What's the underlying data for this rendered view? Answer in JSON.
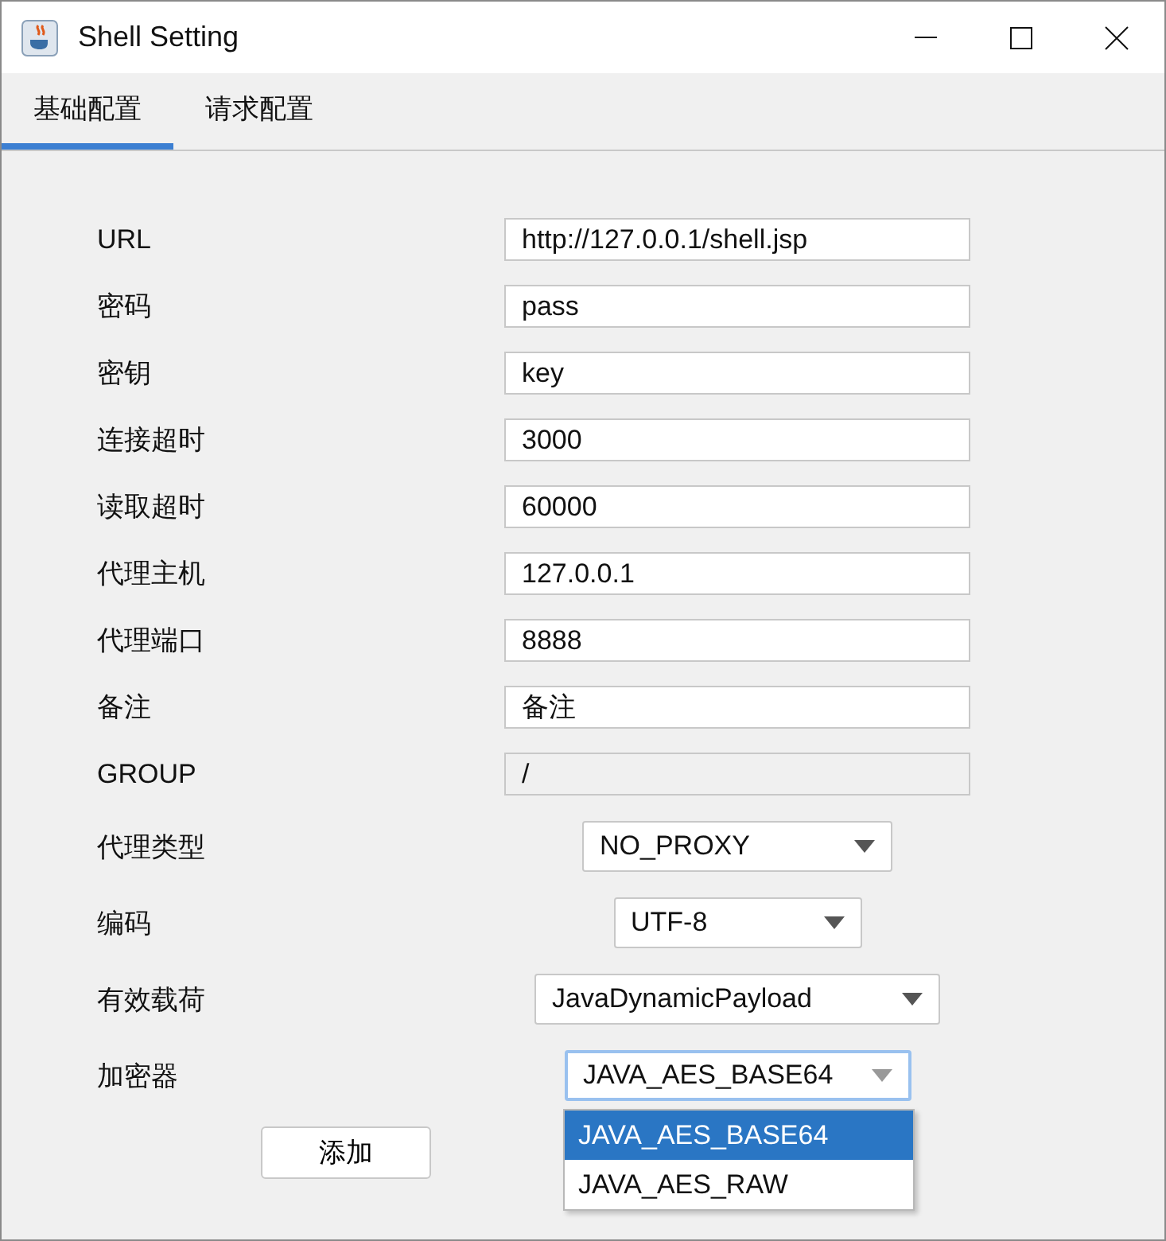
{
  "window": {
    "title": "Shell Setting"
  },
  "tabs": [
    {
      "label": "基础配置",
      "selected": true
    },
    {
      "label": "请求配置",
      "selected": false
    }
  ],
  "fields": [
    {
      "label": "URL",
      "value": "http://127.0.0.1/shell.jsp",
      "disabled": false
    },
    {
      "label": "密码",
      "value": "pass",
      "disabled": false
    },
    {
      "label": "密钥",
      "value": "key",
      "disabled": false
    },
    {
      "label": "连接超时",
      "value": "3000",
      "disabled": false
    },
    {
      "label": "读取超时",
      "value": "60000",
      "disabled": false
    },
    {
      "label": "代理主机",
      "value": "127.0.0.1",
      "disabled": false
    },
    {
      "label": "代理端口",
      "value": "8888",
      "disabled": false
    },
    {
      "label": "备注",
      "value": "备注",
      "disabled": false
    },
    {
      "label": "GROUP",
      "value": "/",
      "disabled": true
    }
  ],
  "combos": [
    {
      "label": "代理类型",
      "value": "NO_PROXY",
      "focused": false,
      "expanded": false
    },
    {
      "label": "编码",
      "value": "UTF-8",
      "focused": false,
      "expanded": false
    },
    {
      "label": "有效载荷",
      "value": "JavaDynamicPayload",
      "focused": false,
      "expanded": false
    },
    {
      "label": "加密器",
      "value": "JAVA_AES_BASE64",
      "focused": true,
      "expanded": true,
      "options": [
        {
          "label": "JAVA_AES_BASE64",
          "selected": true
        },
        {
          "label": "JAVA_AES_RAW",
          "selected": false
        }
      ]
    }
  ],
  "buttons": [
    "添加"
  ]
}
